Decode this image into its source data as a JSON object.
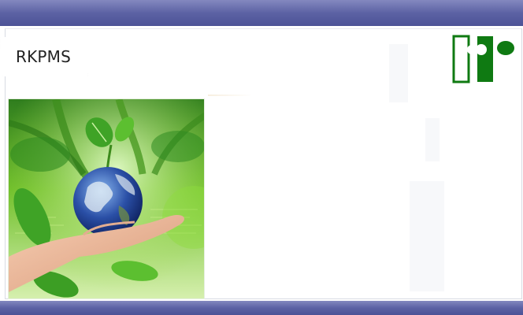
{
  "header": {
    "app_title": "RKPMS",
    "logo_icon": "rkpms-logo-icon",
    "logo_color": "#0f7a12"
  },
  "hero": {
    "image_name": "hands-holding-earth-with-sprout-image"
  },
  "theme": {
    "bar_color": "#5c62a4",
    "page_background": "#ffffff"
  }
}
